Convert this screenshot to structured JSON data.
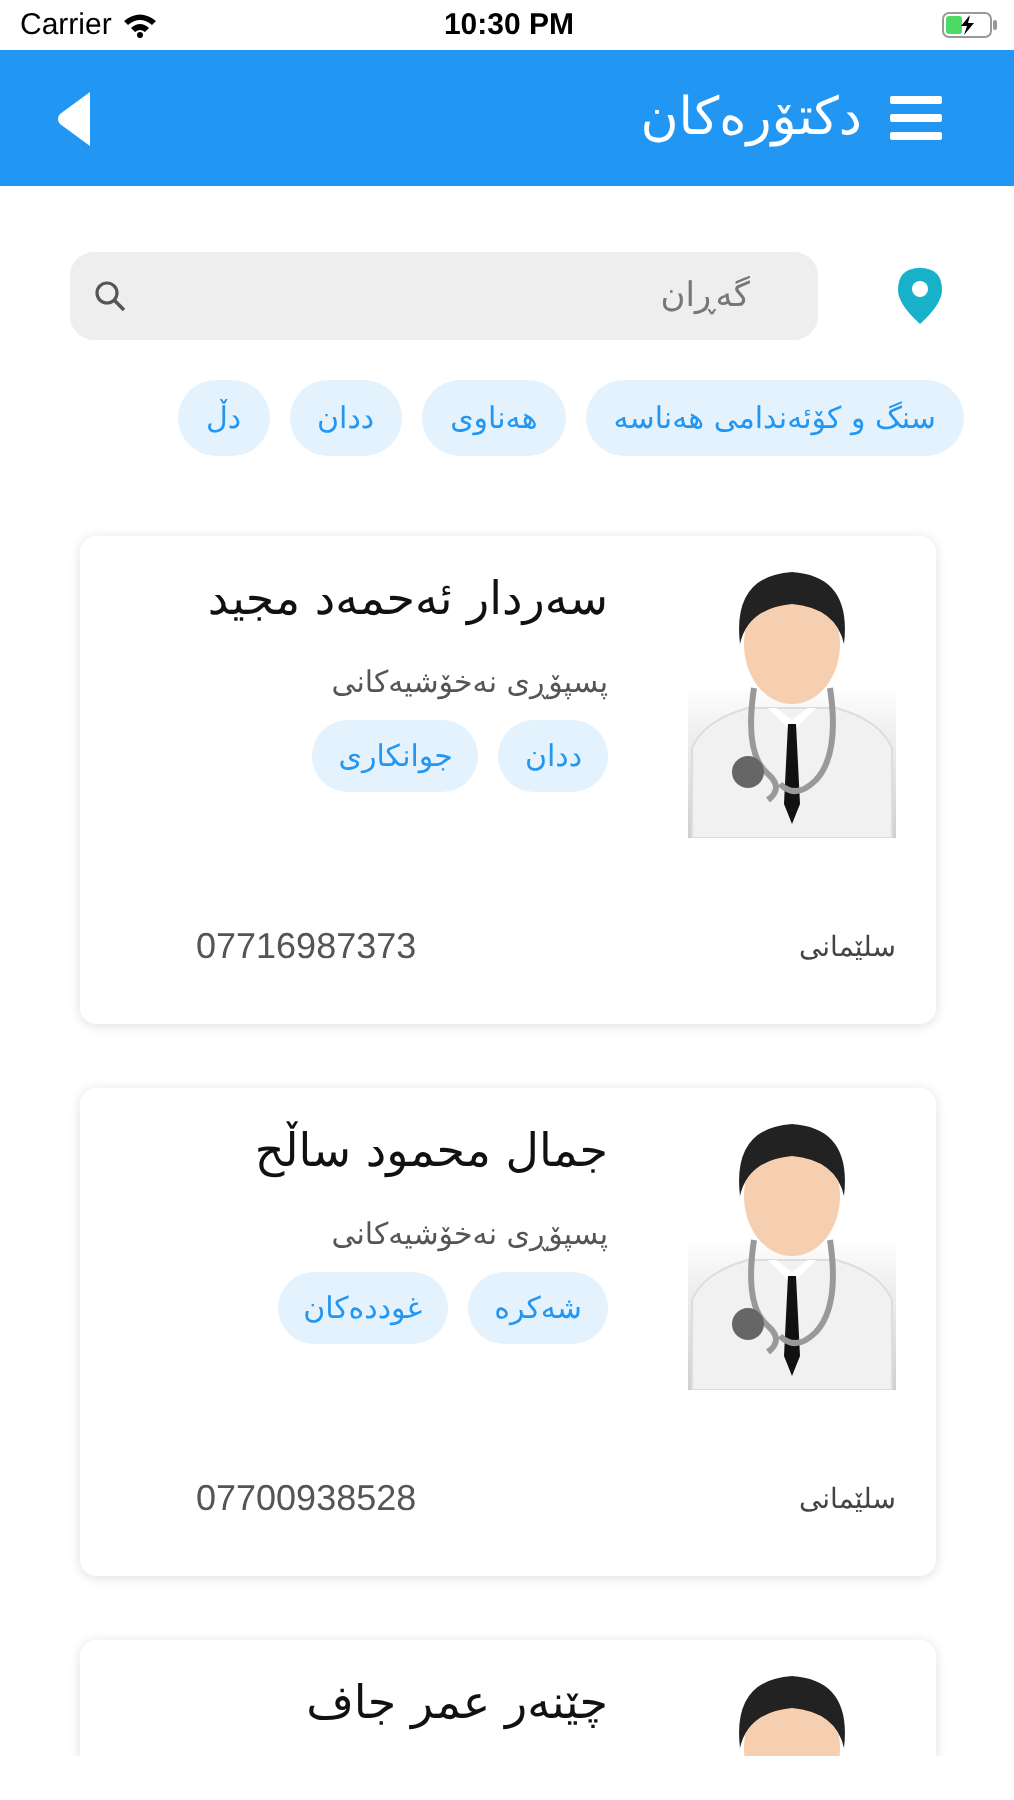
{
  "status_bar": {
    "carrier": "Carrier",
    "time": "10:30 PM"
  },
  "header": {
    "title": "دکتۆرەکان"
  },
  "search": {
    "placeholder": "گەڕان"
  },
  "categories": [
    "سنگ و کۆئەندامی هەناسە",
    "هەناوی",
    "ددان",
    "دڵ"
  ],
  "doctors": [
    {
      "name": "سەردار ئەحمەد مجید",
      "specialty": "پسپۆڕی نەخۆشیەکانی",
      "tags": [
        "ددان",
        "جوانکاری"
      ],
      "city": "سلێمانی",
      "phone": "07716987373"
    },
    {
      "name": "جمال محمود ساڵح",
      "specialty": "پسپۆڕی نەخۆشیەکانی",
      "tags": [
        "شەکرە",
        "غوددەکان"
      ],
      "city": "سلێمانی",
      "phone": "07700938528"
    },
    {
      "name": "چێنەر عمر جاف"
    }
  ]
}
